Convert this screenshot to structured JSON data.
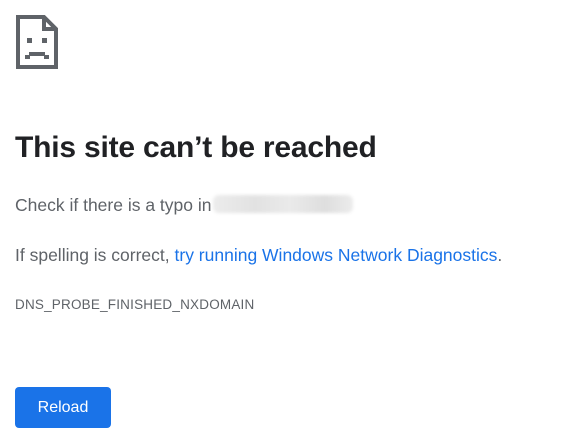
{
  "error": {
    "icon": "sad-page-icon",
    "title": "This site can’t be reached",
    "typo_text": "Check if there is a typo in",
    "spelling_prefix": "If spelling is correct, ",
    "diagnostics_link": "try running Windows Network Diagnostics",
    "spelling_suffix": ".",
    "error_code": "DNS_PROBE_FINISHED_NXDOMAIN"
  },
  "actions": {
    "reload_label": "Reload"
  },
  "colors": {
    "title": "#202124",
    "body_text": "#5f6368",
    "link": "#1a73e8",
    "button_bg": "#1a73e8",
    "button_text": "#ffffff",
    "icon": "#5f6368"
  }
}
